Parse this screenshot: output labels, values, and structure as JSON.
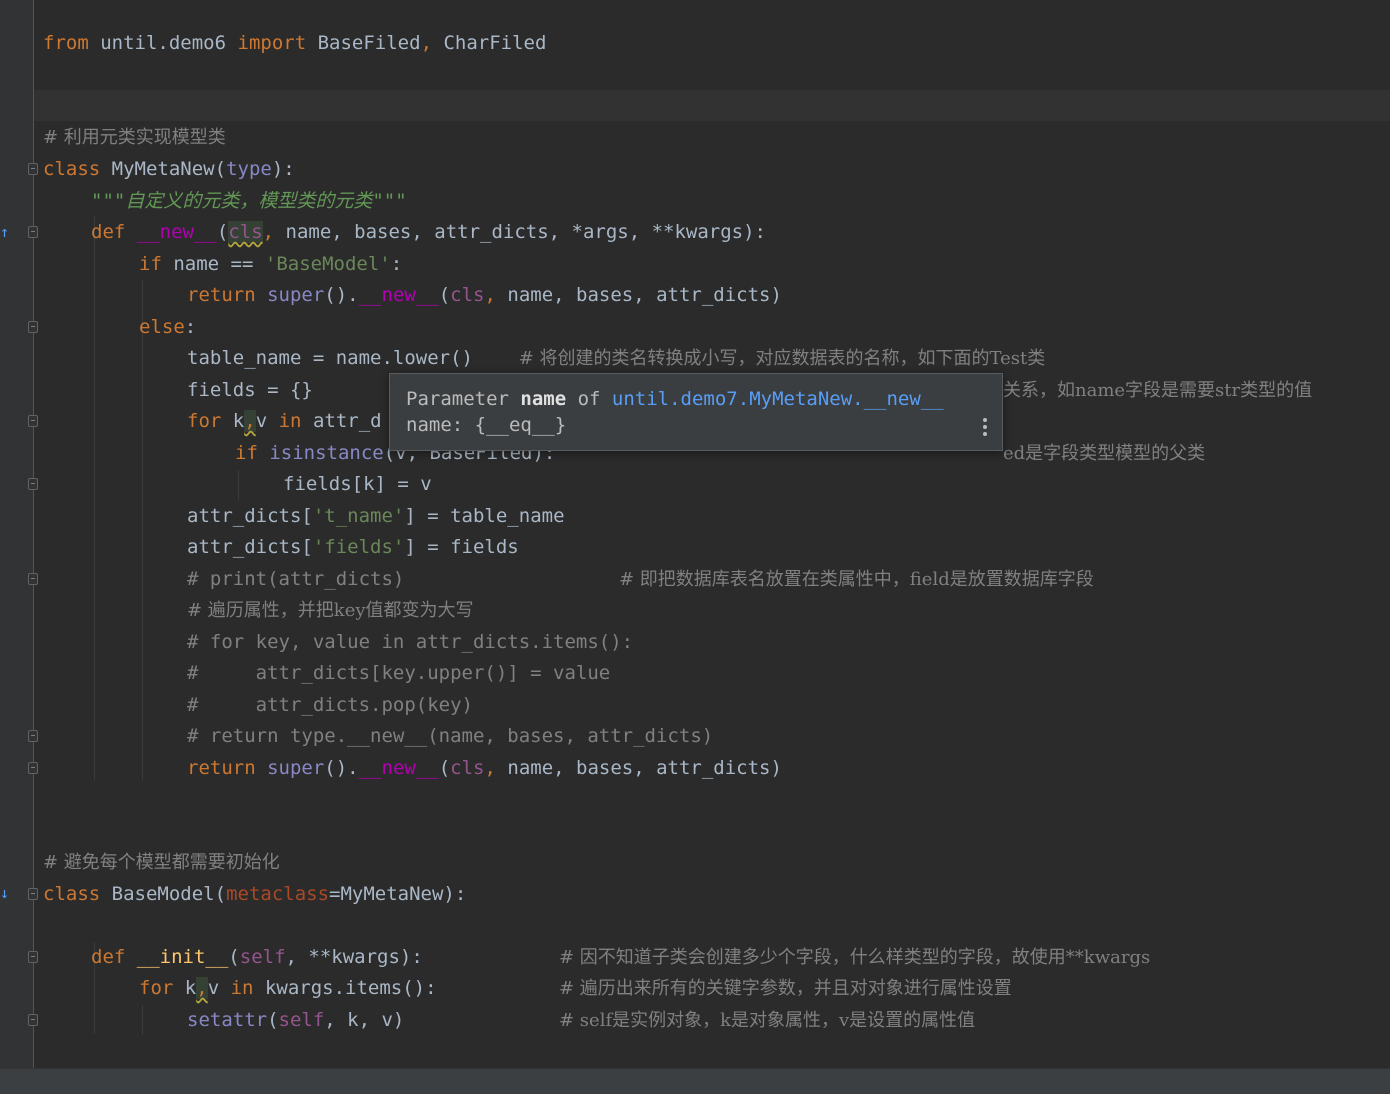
{
  "editor": {
    "line1": {
      "from": "from",
      "module": "until.demo6",
      "import": "import",
      "n1": "BaseFiled",
      "comma": ",",
      "n2": "CharFiled"
    },
    "comment1": "# 利用元类实现模型类",
    "class1": {
      "kw": "class",
      "name": "MyMetaNew",
      "lp": "(",
      "base": "type",
      "rp": "):"
    },
    "docstring": {
      "q1": "\"\"\"",
      "text": "自定义的元类，模型类的元类",
      "q2": "\"\"\""
    },
    "def_new": {
      "kw": "def",
      "name": "__new__",
      "lp": "(",
      "cls": "cls",
      "c1": ",",
      "rest": "name, bases, attr_dicts, *args, **kwargs):"
    },
    "if_line": {
      "kw": "if",
      "mid": "name ==",
      "str": "'BaseModel'",
      "end": ":"
    },
    "return1": {
      "kw": "return",
      "sup": "super",
      "p": "().",
      "nw": "__new__",
      "lp": "(",
      "cls": "cls",
      "c": ",",
      "rest": "name, bases, attr_dicts)"
    },
    "else_line": {
      "kw": "else",
      "end": ":"
    },
    "table_name": {
      "code": "table_name = name.lower()",
      "comment": "# 将创建的类名转换成小写，对应数据表的名称，如下面的Test类"
    },
    "fields_line": {
      "code": "fields = {}",
      "comment_tail": "关系，如name字段是需要str类型的值"
    },
    "for_line": {
      "kw": "for",
      "k": "k",
      "c": ",",
      "v": "v",
      "in": "in",
      "rest": "attr_d"
    },
    "if_isinstance": {
      "kw": "if",
      "fn": "isinstance",
      "rest": "(v, BaseFiled):",
      "comment_tail": "ed是字段类型模型的父类"
    },
    "fields_k": "fields[k] = v",
    "attr1": {
      "a": "attr_dicts[",
      "s": "'t_name'",
      "b": "] = table_name"
    },
    "attr2": {
      "a": "attr_dicts[",
      "s": "'fields'",
      "b": "] = fields"
    },
    "c_print": {
      "code": "# print(attr_dicts)",
      "comment": "# 即把数据库表名放置在类属性中，field是放置数据库字段"
    },
    "c_walk": "# 遍历属性，并把key值都变为大写",
    "c_for": "# for key, value in attr_dicts.items():",
    "c_upper": "#     attr_dicts[key.upper()] = value",
    "c_pop": "#     attr_dicts.pop(key)",
    "c_return": "# return type.__new__(name, bases, attr_dicts)",
    "return2": {
      "kw": "return",
      "sup": "super",
      "p": "().",
      "nw": "__new__",
      "lp": "(",
      "cls": "cls",
      "c": ",",
      "rest": "name, bases, attr_dicts)"
    },
    "comment2": "# 避免每个模型都需要初始化",
    "class2": {
      "kw": "class",
      "name": "BaseModel",
      "lp": "(",
      "meta": "metaclass",
      "rest": "=MyMetaNew):"
    },
    "def_init": {
      "kw": "def",
      "name": "__init__",
      "lp": "(",
      "self": "self",
      "rest": ", **kwargs):",
      "comment": "# 因不知道子类会创建多少个字段，什么样类型的字段，故使用**kwargs"
    },
    "for2": {
      "kw": "for",
      "k": "k",
      "c": ",",
      "v": "v",
      "in": "in",
      "rest": "kwargs.items():",
      "comment": "# 遍历出来所有的关键字参数，并且对对象进行属性设置"
    },
    "setattr": {
      "fn": "setattr",
      "lp": "(",
      "self": "self",
      "rest": ", k, v)",
      "comment": "# self是实例对象，k是对象属性，v是设置的属性值"
    }
  },
  "tooltip": {
    "prefix": "Parameter ",
    "param": "name",
    "of": " of ",
    "link": "until.demo7.MyMetaNew.__new__",
    "type_line": "name: {__eq__}"
  },
  "gutter_icons": {
    "override": "override-icon",
    "implemented": "implemented-icon"
  }
}
